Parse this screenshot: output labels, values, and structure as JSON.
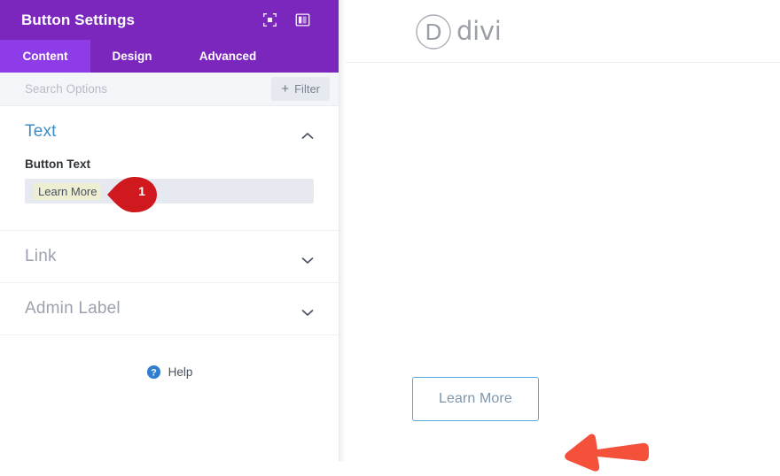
{
  "panel": {
    "title": "Button Settings",
    "header_icons": [
      {
        "name": "focus-target-icon",
        "label": "Focus"
      },
      {
        "name": "layout-panel-icon",
        "label": "Panel Layout"
      }
    ],
    "tabs": [
      {
        "label": "Content",
        "active": true
      },
      {
        "label": "Design",
        "active": false
      },
      {
        "label": "Advanced",
        "active": false
      }
    ],
    "search": {
      "placeholder": "Search Options",
      "value": ""
    },
    "filter_button": {
      "plus": "+",
      "label": "Filter"
    },
    "sections": [
      {
        "title": "Text",
        "state": "open",
        "field_label": "Button Text",
        "field_value": "Learn More"
      },
      {
        "title": "Link",
        "state": "closed"
      },
      {
        "title": "Admin Label",
        "state": "closed"
      }
    ],
    "help": {
      "label": "Help",
      "icon": "question-circle-icon"
    },
    "marker": {
      "number": "1"
    }
  },
  "preview": {
    "logo": {
      "mark_letter": "D",
      "wordmark": "divi"
    },
    "button": {
      "label": "Learn More"
    },
    "annotation_arrow": "left-arrow-annotation"
  },
  "colors": {
    "purple_header": "#7b27bd",
    "purple_tab_active": "#8e3ce8",
    "section_open_title": "#3d8dc4",
    "section_closed_title": "#9ba2ae",
    "input_bg": "#e6e9ef",
    "highlight_yellow": "#eeeed2",
    "marker_red": "#d0191e",
    "arrow_red": "#f4503a",
    "button_border_blue": "#5aa7dd",
    "button_text_blue": "#7e96ab",
    "help_blue": "#2f7ed0"
  }
}
